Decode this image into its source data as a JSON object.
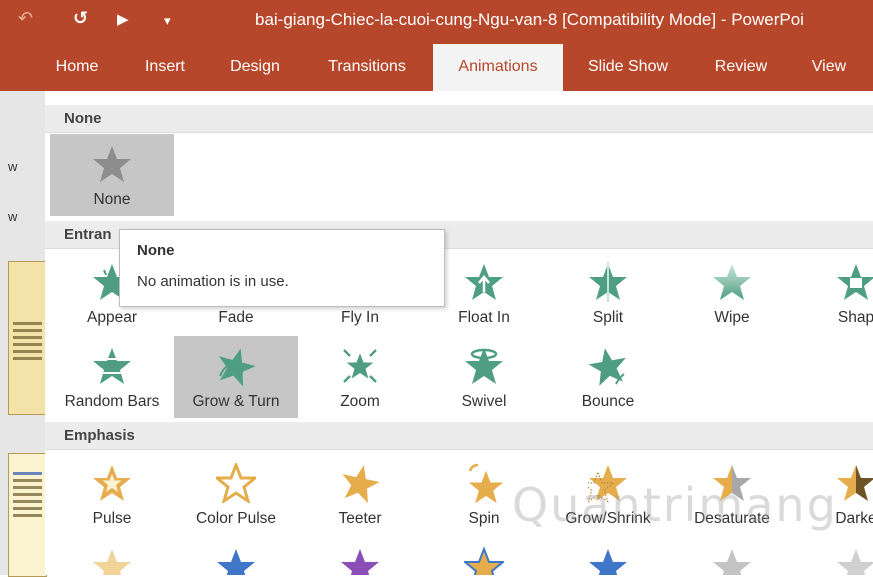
{
  "title_bar": {
    "quick_access": [
      "↶",
      "↺",
      "▶",
      "▾"
    ],
    "title": "bai-giang-Chiec-la-cuoi-cung-Ngu-van-8 [Compatibility Mode] - PowerPoi"
  },
  "tabs": [
    {
      "label": "Home"
    },
    {
      "label": "Insert"
    },
    {
      "label": "Design"
    },
    {
      "label": "Transitions"
    },
    {
      "label": "Animations",
      "active": true
    },
    {
      "label": "Slide Show"
    },
    {
      "label": "Review"
    },
    {
      "label": "View"
    }
  ],
  "left_panel": {
    "text1": "w",
    "text2": "w"
  },
  "sections": {
    "none": "None",
    "entrance": "Entran",
    "emphasis": "Emphasis"
  },
  "none_items": [
    {
      "label": "None"
    }
  ],
  "entrance_items": [
    {
      "label": "Appear",
      "icon": "appear-star-icon"
    },
    {
      "label": "Fade",
      "icon": "fade-star-icon"
    },
    {
      "label": "Fly In",
      "icon": "fly-in-star-icon"
    },
    {
      "label": "Float In",
      "icon": "float-in-star-icon"
    },
    {
      "label": "Split",
      "icon": "split-star-icon"
    },
    {
      "label": "Wipe",
      "icon": "wipe-star-icon"
    },
    {
      "label": "Shap",
      "icon": "shape-star-icon"
    },
    {
      "label": "Random Bars",
      "icon": "random-bars-star-icon"
    },
    {
      "label": "Grow & Turn",
      "icon": "grow-turn-star-icon"
    },
    {
      "label": "Zoom",
      "icon": "zoom-star-icon"
    },
    {
      "label": "Swivel",
      "icon": "swivel-star-icon"
    },
    {
      "label": "Bounce",
      "icon": "bounce-star-icon"
    }
  ],
  "emphasis_items": [
    {
      "label": "Pulse",
      "icon": "pulse-star-icon"
    },
    {
      "label": "Color Pulse",
      "icon": "color-pulse-star-icon"
    },
    {
      "label": "Teeter",
      "icon": "teeter-star-icon"
    },
    {
      "label": "Spin",
      "icon": "spin-star-icon"
    },
    {
      "label": "Grow/Shrink",
      "icon": "grow-shrink-star-icon"
    },
    {
      "label": "Desaturate",
      "icon": "desaturate-star-icon"
    },
    {
      "label": "Darke",
      "icon": "darken-star-icon"
    }
  ],
  "tooltip": {
    "title": "None",
    "description": "No animation is in use."
  },
  "watermark": "Quantrimang",
  "colors": {
    "accent": "#b7472a",
    "entrance_green": "#4f9e83",
    "emphasis_gold": "#e5ad4c",
    "none_gray": "#8d8d8d"
  }
}
